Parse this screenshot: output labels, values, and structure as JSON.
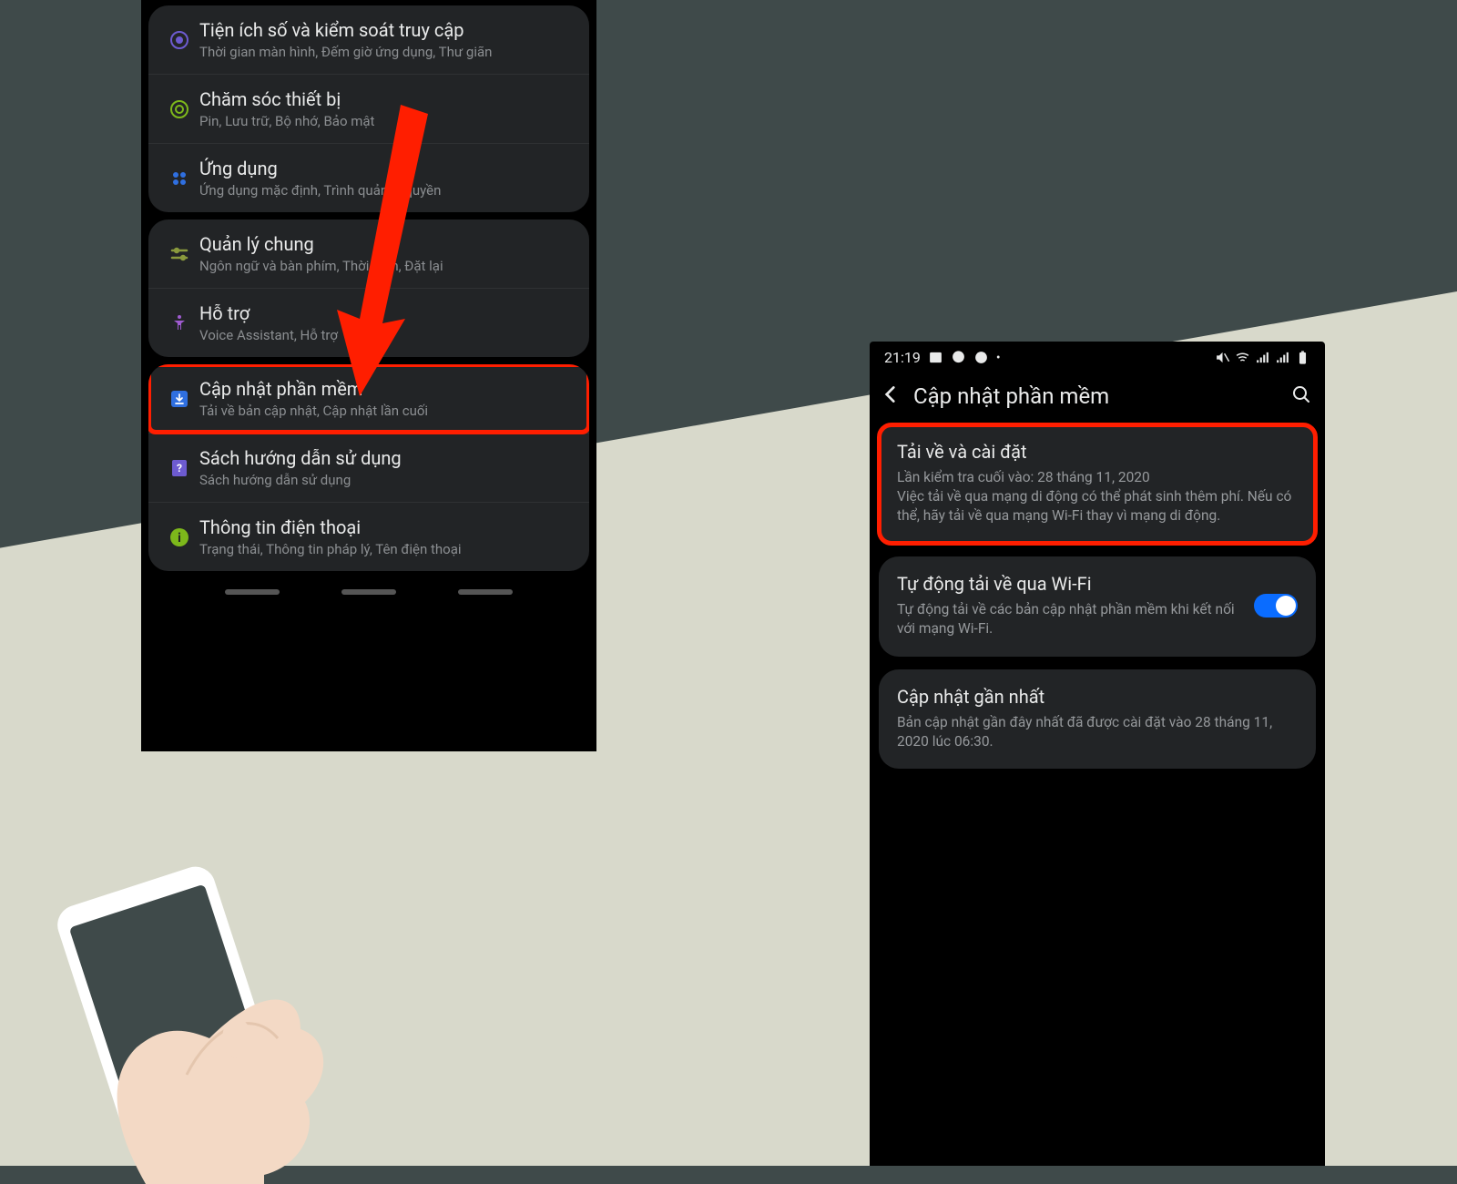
{
  "left_settings": {
    "items": [
      {
        "title": "Tiện ích số và kiểm soát truy cập",
        "sub": "Thời gian màn hình, Đếm giờ ứng dụng, Thư giãn"
      },
      {
        "title": "Chăm sóc thiết bị",
        "sub": "Pin, Lưu trữ, Bộ nhớ, Bảo mật"
      },
      {
        "title": "Ứng dụng",
        "sub": "Ứng dụng mặc định, Trình quản lý quyền"
      },
      {
        "title": "Quản lý chung",
        "sub": "Ngôn ngữ và bàn phím, Thời gian, Đặt lại"
      },
      {
        "title": "Hỗ trợ",
        "sub": "Voice Assistant, Hỗ trợ"
      },
      {
        "title": "Cập nhật phần mềm",
        "sub": "Tải về bản cập nhật, Cập nhật lần cuối"
      },
      {
        "title": "Sách hướng dẫn sử dụng",
        "sub": "Sách hướng dẫn sử dụng"
      },
      {
        "title": "Thông tin điện thoại",
        "sub": "Trạng thái, Thông tin pháp lý, Tên điện thoại"
      }
    ]
  },
  "status_bar": {
    "time": "21:19"
  },
  "header": {
    "title": "Cập nhật phần mềm"
  },
  "blocks": [
    {
      "title": "Tải về và cài đặt",
      "sub": "Lần kiểm tra cuối vào: 28 tháng 11, 2020\nViệc tải về qua mạng di động có thể phát sinh thêm phí. Nếu có thể, hãy tải về qua mạng Wi-Fi thay vì mạng di động."
    },
    {
      "title": "Tự động tải về qua Wi-Fi",
      "sub": "Tự động tải về các bản cập nhật phần mềm khi kết nối với mạng Wi-Fi."
    },
    {
      "title": "Cập nhật gần nhất",
      "sub": "Bản cập nhật gần đây nhất đã được cài đặt vào 28 tháng 11, 2020 lúc 06:30."
    }
  ]
}
